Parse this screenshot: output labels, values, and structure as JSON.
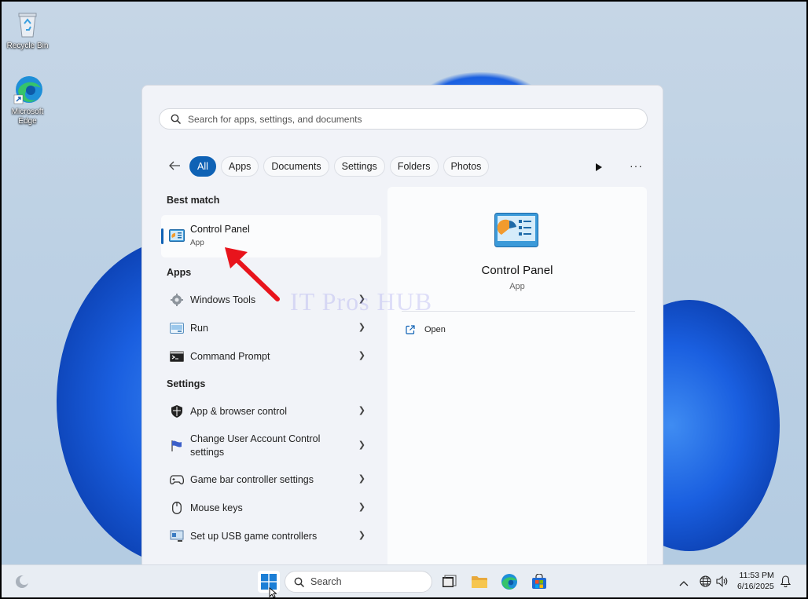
{
  "desktop": {
    "icons": [
      {
        "label": "Recycle Bin"
      },
      {
        "label": "Microsoft Edge"
      }
    ]
  },
  "start_menu": {
    "search_placeholder": "Search for apps, settings, and documents",
    "filters": [
      "All",
      "Apps",
      "Documents",
      "Settings",
      "Folders",
      "Photos"
    ],
    "best_match": {
      "heading": "Best match",
      "title": "Control Panel",
      "subtitle": "App"
    },
    "apps": {
      "heading": "Apps",
      "items": [
        "Windows Tools",
        "Run",
        "Command Prompt"
      ]
    },
    "settings": {
      "heading": "Settings",
      "items": [
        "App & browser control",
        "Change User Account Control settings",
        "Game bar controller settings",
        "Mouse keys",
        "Set up USB game controllers"
      ]
    },
    "details": {
      "title": "Control Panel",
      "subtitle": "App",
      "action": "Open"
    },
    "watermark": "IT Pros HUB"
  },
  "taskbar": {
    "search_label": "Search",
    "time": "11:53 PM",
    "date": "6/16/2025"
  },
  "colors": {
    "accent": "#0f62b5",
    "arrow": "#e8141c"
  }
}
